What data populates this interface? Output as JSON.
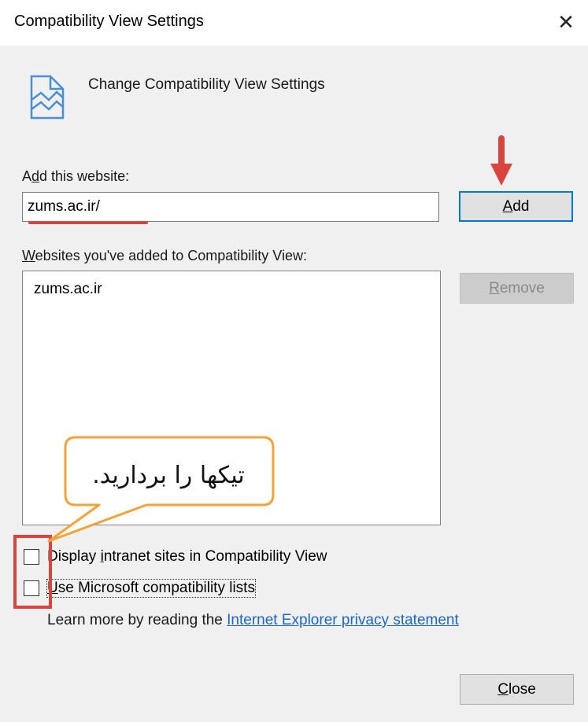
{
  "window": {
    "title": "Compatibility View Settings",
    "close_glyph": "✕"
  },
  "header": {
    "icon": "compatibility-view-broken-page-icon",
    "text": "Change Compatibility View Settings"
  },
  "add_website": {
    "label_prefix": "A",
    "label_mnemonic": "d",
    "label_suffix": "d this website:",
    "input_value": "zums.ac.ir/",
    "add_button_mnemonic": "A",
    "add_button_rest": "dd"
  },
  "websites_list": {
    "label_mnemonic": "W",
    "label_rest": "ebsites you've added to Compatibility View:",
    "items": [
      "zums.ac.ir"
    ],
    "remove_button_mnemonic": "R",
    "remove_button_rest": "emove"
  },
  "options": {
    "intranet": {
      "checked": false,
      "label_prefix": "Display ",
      "label_mnemonic": "i",
      "label_suffix": "ntranet sites in Compatibility View"
    },
    "ms_lists": {
      "checked": false,
      "label_mnemonic": "U",
      "label_rest": "se Microsoft compatibility lists"
    }
  },
  "learn_more": {
    "text": "Learn more by reading the ",
    "link": "Internet Explorer privacy statement"
  },
  "close_button": {
    "mnemonic": "C",
    "rest": "lose"
  },
  "annotation": {
    "callout_text": "تیکها را بردارید.",
    "color_red": "#d9443e",
    "color_orange": "#f2a33a"
  }
}
